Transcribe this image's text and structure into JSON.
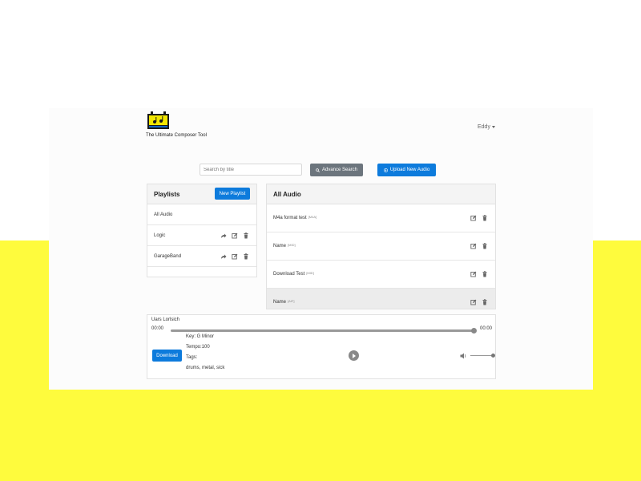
{
  "header": {
    "tagline": "The Ultimate Composer Tool",
    "user_name": "Eddy"
  },
  "toolbar": {
    "search_placeholder": "Search by title",
    "advance_search_label": "Advance Search",
    "upload_label": "Upload New Audio"
  },
  "playlists": {
    "title": "Playlists",
    "new_playlist_label": "New Playlist",
    "items": [
      {
        "label": "All Audio"
      },
      {
        "label": "Logic"
      },
      {
        "label": "GarageBand"
      }
    ]
  },
  "all_audio": {
    "title": "All Audio",
    "items": [
      {
        "name": "M4a format test",
        "ext": "[M4A]"
      },
      {
        "name": "Name",
        "ext": "[MID]"
      },
      {
        "name": "Download Test",
        "ext": "[MID]"
      },
      {
        "name": "Name",
        "ext": "[AIF]"
      }
    ]
  },
  "player": {
    "artist": "Uars Lorlsich",
    "time_current": "00:00",
    "time_total": "00:00",
    "progress": 1.0,
    "volume": 1.0,
    "key": "Key: G Minor",
    "tempo": "Tempo:100",
    "tags_label": "Tags:",
    "tags": "drums, metal, sick",
    "download_label": "Download"
  },
  "colors": {
    "primary": "#0d7bdc",
    "secondary": "#6c757d",
    "accent_yellow": "#fefb3d"
  }
}
